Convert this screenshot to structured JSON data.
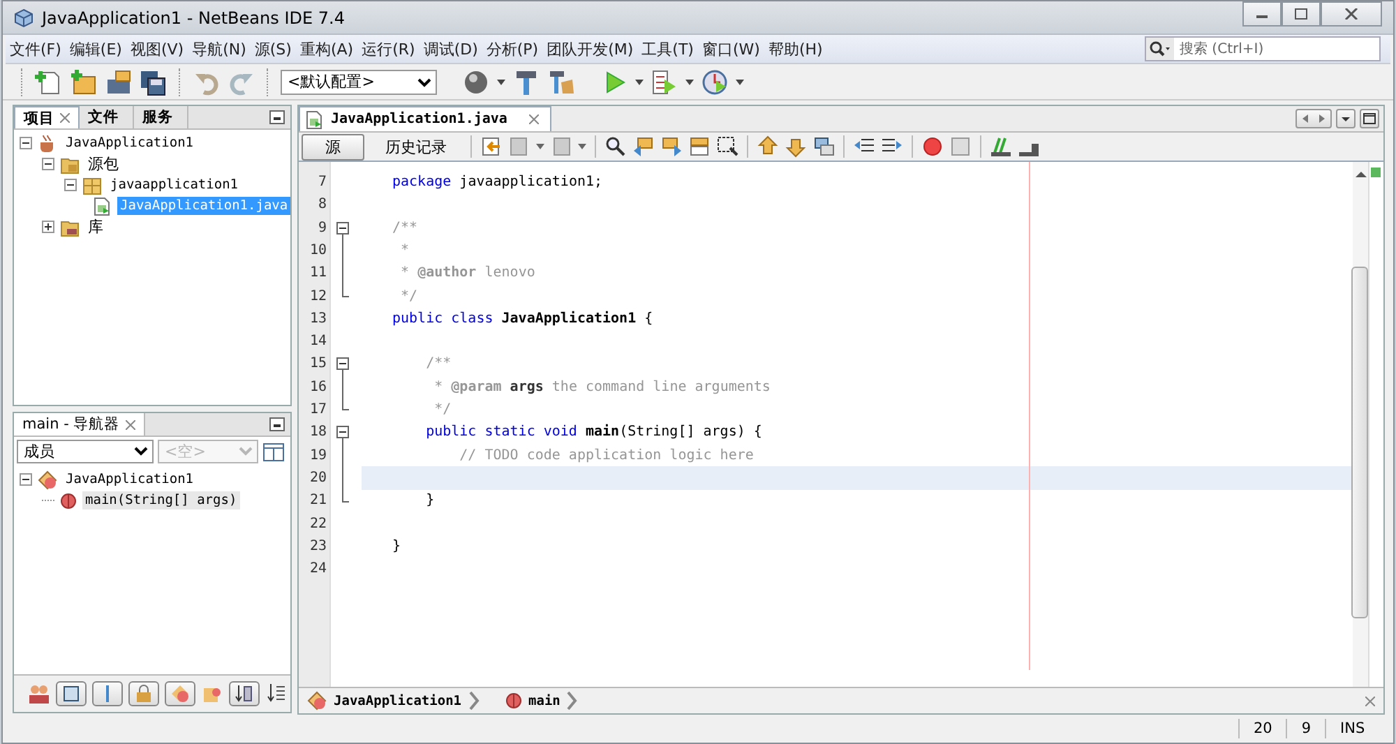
{
  "window": {
    "title": "JavaApplication1 - NetBeans IDE 7.4"
  },
  "menu": [
    "文件(F)",
    "编辑(E)",
    "视图(V)",
    "导航(N)",
    "源(S)",
    "重构(A)",
    "运行(R)",
    "调试(D)",
    "分析(P)",
    "团队开发(M)",
    "工具(T)",
    "窗口(W)",
    "帮助(H)"
  ],
  "search": {
    "placeholder": "搜索 (Ctrl+I)"
  },
  "toolbar": {
    "config": "<默认配置>"
  },
  "projects_panel": {
    "tabs": [
      {
        "label": "项目",
        "selected": true
      },
      {
        "label": "文件",
        "selected": false
      },
      {
        "label": "服务",
        "selected": false
      }
    ],
    "tree": [
      {
        "label": "JavaApplication1",
        "kind": "project",
        "expanded": true,
        "selected": false,
        "children": [
          {
            "label": "源包",
            "kind": "source-package",
            "expanded": true,
            "selected": false,
            "children": [
              {
                "label": "javaapplication1",
                "kind": "package",
                "expanded": true,
                "selected": false,
                "children": [
                  {
                    "label": "JavaApplication1.java",
                    "kind": "java-file",
                    "selected": true
                  }
                ]
              }
            ]
          },
          {
            "label": "库",
            "kind": "libraries",
            "expanded": false,
            "selected": false
          }
        ]
      }
    ]
  },
  "navigator": {
    "title": "main - 导航器",
    "filter": "成员",
    "member": {
      "placeholder": "<空>",
      "disabled": true
    },
    "tree": [
      {
        "label": "JavaApplication1",
        "kind": "class",
        "expanded": true,
        "selected": false,
        "children": [
          {
            "label": "main(String[] args)",
            "kind": "method",
            "selected": true
          }
        ]
      }
    ]
  },
  "editor": {
    "file_tab": "JavaApplication1.java",
    "view_tabs": [
      {
        "label": "源",
        "selected": true
      },
      {
        "label": "历史记录",
        "selected": false
      }
    ],
    "lines": [
      {
        "number": "7",
        "current": false,
        "kind": "plain",
        "tokens": [
          {
            "text": "package",
            "kind": "keyword"
          },
          {
            "text": " javaapplication1;",
            "kind": "plain"
          }
        ]
      },
      {
        "number": "8",
        "current": false,
        "kind": "plain"
      },
      {
        "number": "9",
        "current": false,
        "kind": "fold-start",
        "tokens": [
          {
            "text": "/**",
            "kind": "comment"
          }
        ]
      },
      {
        "number": "10",
        "current": false,
        "kind": "fold-body",
        "tokens": [
          {
            "text": " *",
            "kind": "comment"
          }
        ]
      },
      {
        "number": "11",
        "current": false,
        "kind": "fold-body",
        "tokens": [
          {
            "text": " * ",
            "kind": "comment"
          },
          {
            "text": "@author",
            "kind": "doctag"
          },
          {
            "text": " lenovo",
            "kind": "comment"
          }
        ]
      },
      {
        "number": "12",
        "current": false,
        "kind": "fold-end",
        "tokens": [
          {
            "text": " */",
            "kind": "comment"
          }
        ]
      },
      {
        "number": "13",
        "current": false,
        "kind": "plain",
        "tokens": [
          {
            "text": "public class",
            "kind": "keyword"
          },
          {
            "text": " JavaApplication1",
            "kind": "declaration"
          },
          {
            "text": " {",
            "kind": "plain"
          }
        ]
      },
      {
        "number": "14",
        "current": false,
        "kind": "plain"
      },
      {
        "number": "15",
        "current": false,
        "kind": "fold-start",
        "tokens": [
          {
            "text": "    /**",
            "kind": "comment"
          }
        ]
      },
      {
        "number": "16",
        "current": false,
        "kind": "fold-body",
        "tokens": [
          {
            "text": "     * ",
            "kind": "comment"
          },
          {
            "text": "@param",
            "kind": "doctag"
          },
          {
            "text": " args",
            "kind": "docparam"
          },
          {
            "text": " the command line arguments",
            "kind": "comment"
          }
        ]
      },
      {
        "number": "17",
        "current": false,
        "kind": "fold-end",
        "tokens": [
          {
            "text": "     */",
            "kind": "comment"
          }
        ]
      },
      {
        "number": "18",
        "current": false,
        "kind": "fold-start",
        "tokens": [
          {
            "text": "    public static void",
            "kind": "keyword"
          },
          {
            "text": " main",
            "kind": "declaration"
          },
          {
            "text": "(String[] args) {",
            "kind": "plain"
          }
        ]
      },
      {
        "number": "19",
        "current": false,
        "kind": "fold-body",
        "tokens": [
          {
            "text": "        // TODO code application logic here",
            "kind": "comment"
          }
        ]
      },
      {
        "number": "20",
        "current": true,
        "kind": "fold-body"
      },
      {
        "number": "21",
        "current": false,
        "kind": "fold-end",
        "tokens": [
          {
            "text": "    }",
            "kind": "plain"
          }
        ]
      },
      {
        "number": "22",
        "current": false,
        "kind": "plain"
      },
      {
        "number": "23",
        "current": false,
        "kind": "plain",
        "tokens": [
          {
            "text": "}",
            "kind": "plain"
          }
        ]
      },
      {
        "number": "24",
        "current": false,
        "kind": "plain"
      }
    ],
    "breadcrumbs": [
      {
        "label": "JavaApplication1",
        "kind": "class"
      },
      {
        "label": "main",
        "kind": "method"
      }
    ]
  },
  "status_bar": {
    "line": "20",
    "column": "9",
    "mode": "INS"
  }
}
